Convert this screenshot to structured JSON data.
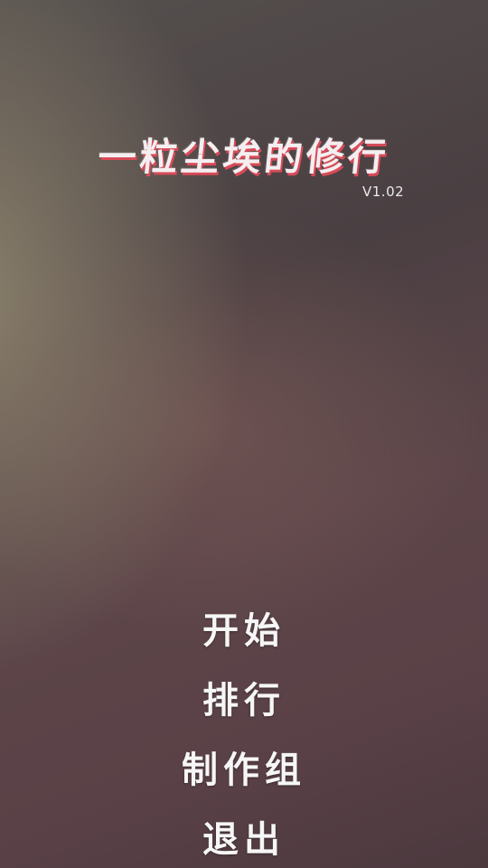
{
  "game": {
    "title": "一粒尘埃的修行",
    "version": "V1.02"
  },
  "menu": {
    "items": [
      {
        "id": "start",
        "label": "开始"
      },
      {
        "id": "ranking",
        "label": "排行"
      },
      {
        "id": "credits",
        "label": "制作组"
      },
      {
        "id": "exit",
        "label": "退出"
      }
    ]
  },
  "colors": {
    "title_shadow": "#d84a58",
    "text": "#f6f6f6"
  }
}
